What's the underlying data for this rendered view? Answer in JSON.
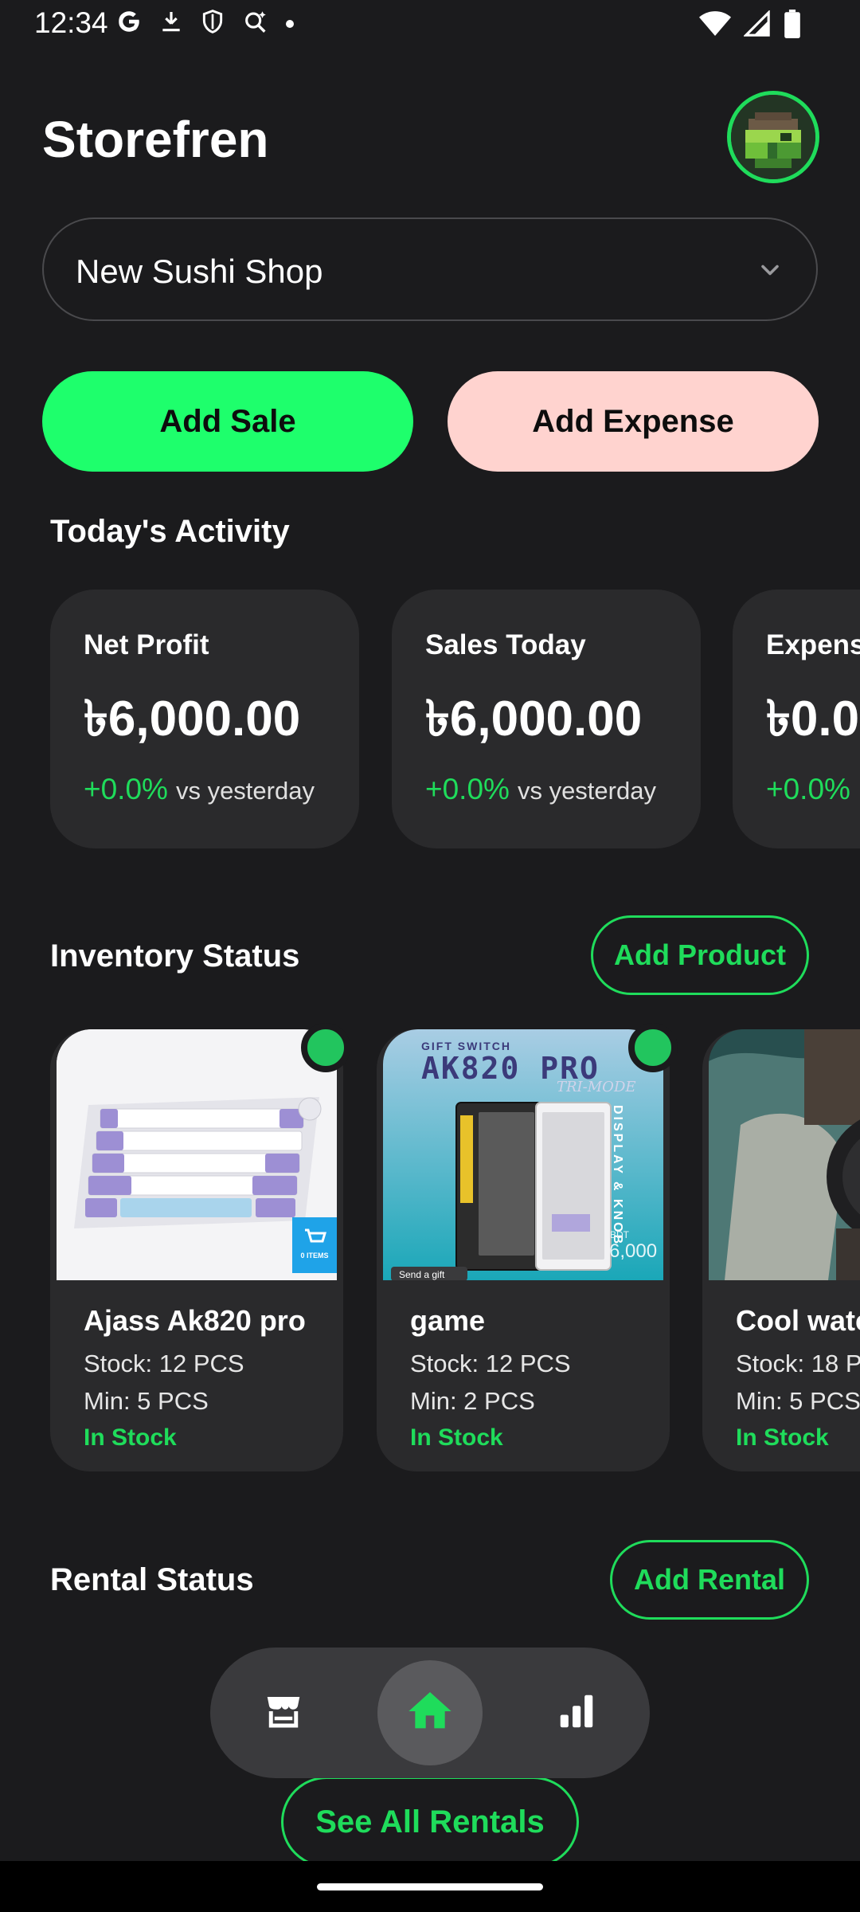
{
  "status_bar": {
    "time": "12:34",
    "left_icons": [
      "google-icon",
      "download-icon",
      "shield-icon",
      "assistant-sparkle-icon",
      "dot-icon"
    ],
    "right_icons": [
      "wifi-icon",
      "signal-icon",
      "battery-icon"
    ]
  },
  "header": {
    "title": "Storefren",
    "avatar_icon": "pixel-avatar-icon"
  },
  "shop_selector": {
    "value": "New Sushi Shop",
    "icon": "chevron-down-icon"
  },
  "actions": {
    "add_sale": "Add Sale",
    "add_expense": "Add Expense"
  },
  "activity": {
    "title": "Today's Activity",
    "cards": [
      {
        "label": "Net Profit",
        "value": "৳6,000.00",
        "change": "+0.0%",
        "compare": "vs yesterday"
      },
      {
        "label": "Sales Today",
        "value": "৳6,000.00",
        "change": "+0.0%",
        "compare": "vs yesterday"
      },
      {
        "label": "Expens",
        "value": "৳0.0",
        "change": "+0.0%",
        "compare": ""
      }
    ]
  },
  "inventory": {
    "title": "Inventory Status",
    "add_button": "Add Product",
    "products": [
      {
        "name": "Ajass Ak820 pro",
        "stock": "Stock: 12 PCS",
        "min": "Min: 5 PCS",
        "status": "In Stock",
        "badge_text": "0 ITEMS"
      },
      {
        "name": "game",
        "stock": "Stock: 12 PCS",
        "min": "Min: 2 PCS",
        "status": "In Stock",
        "img_small": "GIFT SWITCH",
        "img_big": "AK820 PRO",
        "img_script": "TRI-MODE",
        "img_side": "DISPLAY & KNOB",
        "img_currency": "BDT",
        "img_price": "6,000",
        "img_gift": "Send a gift"
      },
      {
        "name": "Cool watc",
        "stock": "Stock: 18 P",
        "min": "Min: 5 PCS",
        "status": "In Stock"
      }
    ]
  },
  "rentals": {
    "title": "Rental Status",
    "add_button": "Add Rental",
    "see_all": "See All Rentals"
  },
  "bottom_nav": {
    "items": [
      {
        "icon": "store-icon",
        "active": false
      },
      {
        "icon": "home-icon",
        "active": true
      },
      {
        "icon": "bar-chart-icon",
        "active": false
      }
    ]
  },
  "colors": {
    "background": "#1b1b1d",
    "card": "#2a2a2c",
    "accent_green": "#1fdc5b",
    "sale_button": "#1eff6c",
    "expense_button": "#ffd3cf"
  }
}
